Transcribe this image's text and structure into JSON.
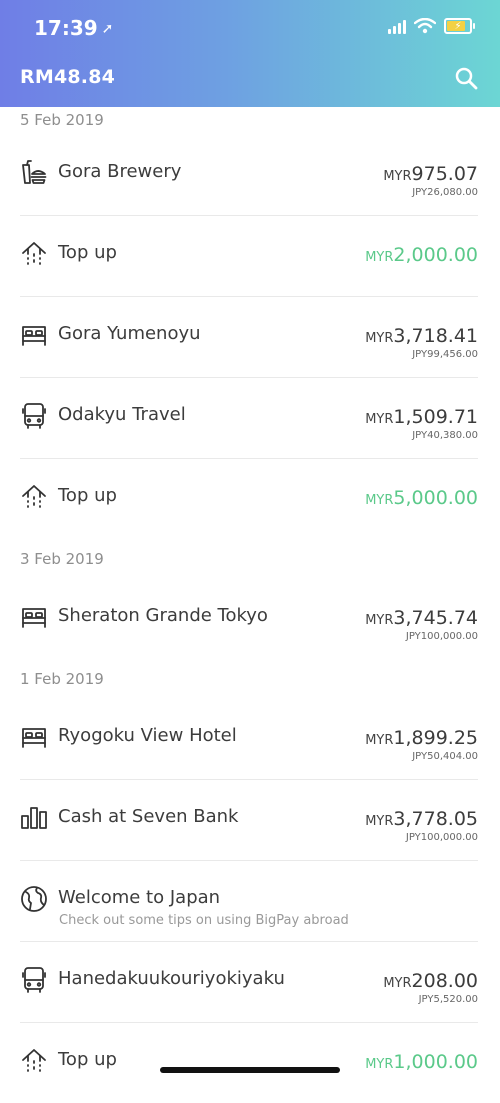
{
  "status_bar": {
    "time": "17:39"
  },
  "header": {
    "balance": "RM48.84"
  },
  "groups": [
    {
      "date": "5 Feb 2019",
      "items": [
        {
          "icon": "food-icon",
          "name": "Gora Brewery",
          "currency": "MYR",
          "amount": "975.07",
          "foreign": "JPY26,080.00",
          "credit": false
        },
        {
          "icon": "topup-icon",
          "name": "Top up",
          "currency": "MYR",
          "amount": "2,000.00",
          "foreign": "",
          "credit": true
        },
        {
          "icon": "bed-icon",
          "name": "Gora Yumenoyu",
          "currency": "MYR",
          "amount": "3,718.41",
          "foreign": "JPY99,456.00",
          "credit": false
        },
        {
          "icon": "bus-icon",
          "name": "Odakyu Travel",
          "currency": "MYR",
          "amount": "1,509.71",
          "foreign": "JPY40,380.00",
          "credit": false
        },
        {
          "icon": "topup-icon",
          "name": "Top up",
          "currency": "MYR",
          "amount": "5,000.00",
          "foreign": "",
          "credit": true
        }
      ]
    },
    {
      "date": "3 Feb 2019",
      "items": [
        {
          "icon": "bed-icon",
          "name": "Sheraton Grande Tokyo",
          "currency": "MYR",
          "amount": "3,745.74",
          "foreign": "JPY100,000.00",
          "credit": false
        }
      ]
    },
    {
      "date": "1 Feb 2019",
      "items": [
        {
          "icon": "bed-icon",
          "name": "Ryogoku View Hotel",
          "currency": "MYR",
          "amount": "1,899.25",
          "foreign": "JPY50,404.00",
          "credit": false
        },
        {
          "icon": "cash-icon",
          "name": "Cash at Seven Bank",
          "currency": "MYR",
          "amount": "3,778.05",
          "foreign": "JPY100,000.00",
          "credit": false
        },
        {
          "icon": "globe-icon",
          "name": "Welcome to Japan",
          "subtitle": "Check out some tips on using BigPay abroad",
          "currency": "",
          "amount": "",
          "foreign": "",
          "credit": false
        },
        {
          "icon": "bus-icon",
          "name": "Hanedakuukouriyokiyaku",
          "currency": "MYR",
          "amount": "208.00",
          "foreign": "JPY5,520.00",
          "credit": false
        },
        {
          "icon": "topup-icon",
          "name": "Top up",
          "currency": "MYR",
          "amount": "1,000.00",
          "foreign": "",
          "credit": true
        }
      ]
    }
  ],
  "colors": {
    "credit": "#5bc98a",
    "header_start": "#6f7ee6",
    "header_end": "#6cd6d4"
  }
}
